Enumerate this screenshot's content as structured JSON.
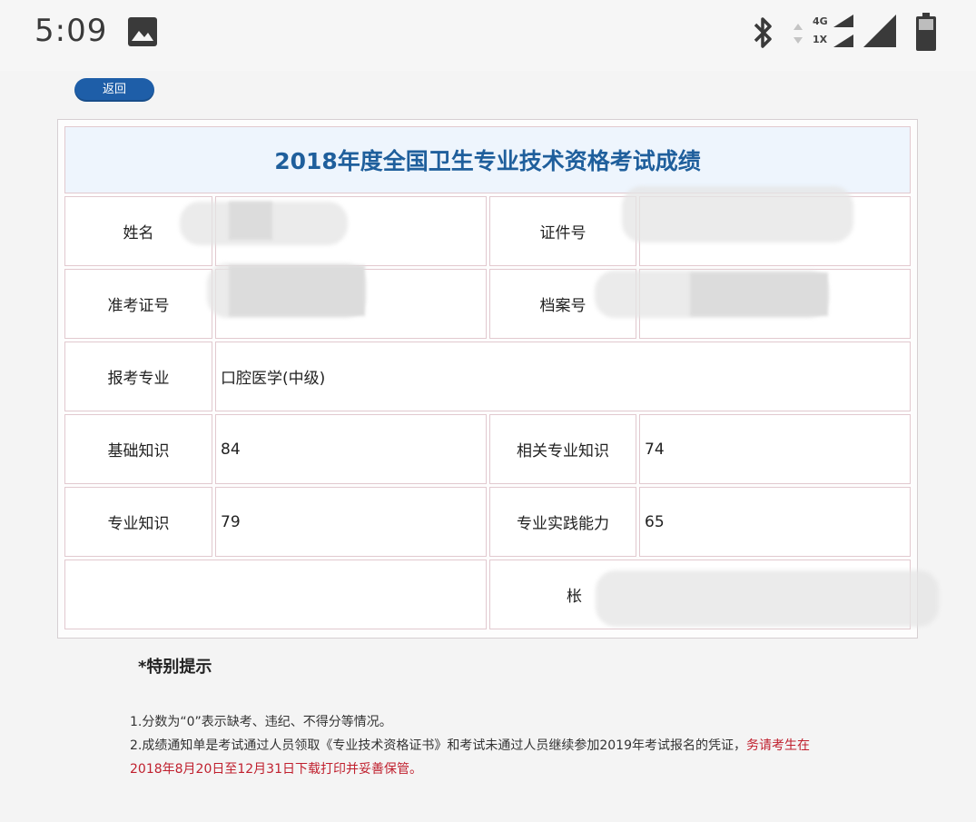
{
  "status_bar": {
    "time": "5:09",
    "network_top": "4G",
    "network_bottom": "1X",
    "icons": [
      "image-icon",
      "bluetooth-icon",
      "data-arrows-icon",
      "signal-icon",
      "battery-icon"
    ]
  },
  "page": {
    "back_label": "返回",
    "table_title": "2018年度全国卫生专业技术资格考试成绩",
    "rows": {
      "name_label": "姓名",
      "id_label": "证件号",
      "ticket_label": "准考证号",
      "archive_label": "档案号",
      "major_label": "报考专业",
      "major_value": "口腔医学(中级)",
      "basic_label": "基础知识",
      "basic_value": "84",
      "related_label": "相关专业知识",
      "related_value": "74",
      "professional_label": "专业知识",
      "professional_value": "79",
      "practice_label": "专业实践能力",
      "practice_value": "65",
      "partial_label": "枨"
    },
    "notice": {
      "title": "*特别提示",
      "line1": "1.分数为“0”表示缺考、违纪、不得分等情况。",
      "line2_prefix": "2.成绩通知单是考试通过人员领取《专业技术资格证书》和考试未通过人员继续参加2019年考试报名的凭证，",
      "line2_warning": "务请考生在2018年8月20日至12月31日下载打印并妥善保管。"
    }
  },
  "colors": {
    "button_blue": "#1e5ea8",
    "title_blue": "#1f5f9c",
    "title_bg": "#eef5fd",
    "cell_border": "#e2c9cf",
    "warning_red": "#c0202e"
  }
}
